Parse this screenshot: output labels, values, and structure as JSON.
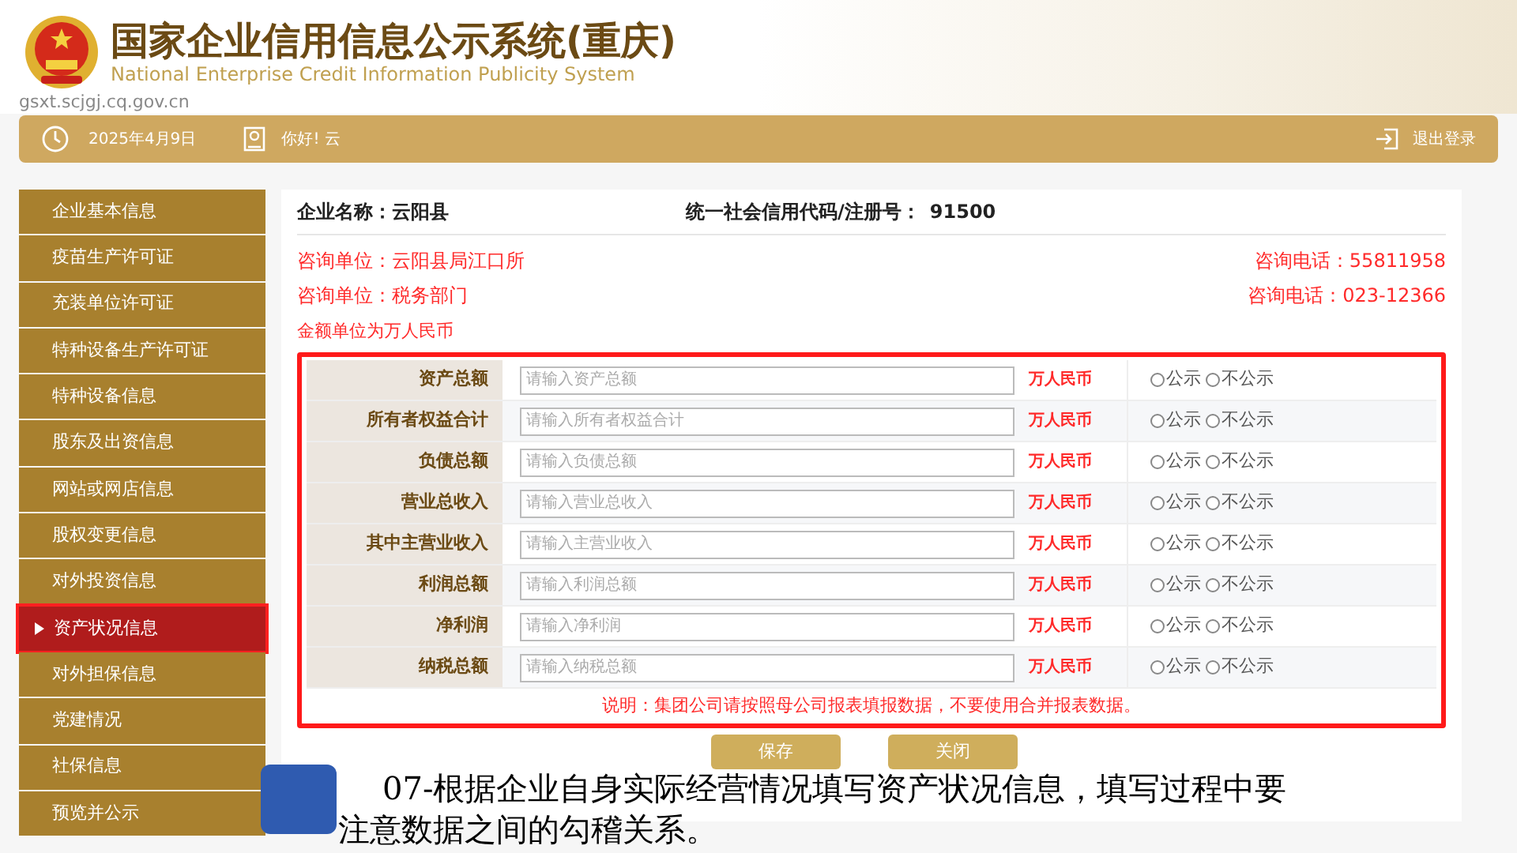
{
  "header": {
    "title": "国家企业信用信息公示系统(重庆)",
    "subtitle": "National Enterprise Credit Information Publicity System",
    "url": "gsxt.scjgj.cq.gov.cn"
  },
  "top_bar": {
    "date": "2025年4月9日",
    "greeting": "你好! 云",
    "logout": "退出登录"
  },
  "sidebar": {
    "items": [
      {
        "label": "企业基本信息",
        "selected": false
      },
      {
        "label": "疫苗生产许可证",
        "selected": false
      },
      {
        "label": "充装单位许可证",
        "selected": false
      },
      {
        "label": "特种设备生产许可证",
        "selected": false
      },
      {
        "label": "特种设备信息",
        "selected": false
      },
      {
        "label": "股东及出资信息",
        "selected": false
      },
      {
        "label": "网站或网店信息",
        "selected": false
      },
      {
        "label": "股权变更信息",
        "selected": false
      },
      {
        "label": "对外投资信息",
        "selected": false
      },
      {
        "label": "资产状况信息",
        "selected": true
      },
      {
        "label": "对外担保信息",
        "selected": false
      },
      {
        "label": "党建情况",
        "selected": false
      },
      {
        "label": "社保信息",
        "selected": false
      },
      {
        "label": "预览并公示",
        "selected": false
      }
    ]
  },
  "company": {
    "name_label": "企业名称：",
    "name": "云阳县",
    "code_label": "统一社会信用代码/注册号：",
    "code": "91500"
  },
  "contacts": [
    {
      "unit": "咨询单位：云阳县局江口所",
      "phone": "咨询电话：55811958"
    },
    {
      "unit": "咨询单位：税务部门",
      "phone": "咨询电话：023-12366"
    }
  ],
  "amount_note": "金额单位为万人民币",
  "form": {
    "rows": [
      {
        "label": "资产总额",
        "placeholder": "请输入资产总额",
        "unit": "万人民币",
        "options": [
          {
            "label": "公示",
            "checked": false
          },
          {
            "label": "不公示",
            "checked": false
          }
        ]
      },
      {
        "label": "所有者权益合计",
        "placeholder": "请输入所有者权益合计",
        "unit": "万人民币",
        "options": [
          {
            "label": "公示",
            "checked": false
          },
          {
            "label": "不公示",
            "checked": false
          }
        ]
      },
      {
        "label": "负债总额",
        "placeholder": "请输入负债总额",
        "unit": "万人民币",
        "options": [
          {
            "label": "公示",
            "checked": false
          },
          {
            "label": "不公示",
            "checked": false
          }
        ]
      },
      {
        "label": "营业总收入",
        "placeholder": "请输入营业总收入",
        "unit": "万人民币",
        "options": [
          {
            "label": "公示",
            "checked": false
          },
          {
            "label": "不公示",
            "checked": false
          }
        ]
      },
      {
        "label": "其中主营业收入",
        "placeholder": "请输入主营业收入",
        "unit": "万人民币",
        "options": [
          {
            "label": "公示",
            "checked": false
          },
          {
            "label": "不公示",
            "checked": false
          }
        ]
      },
      {
        "label": "利润总额",
        "placeholder": "请输入利润总额",
        "unit": "万人民币",
        "options": [
          {
            "label": "公示",
            "checked": false
          },
          {
            "label": "不公示",
            "checked": false
          }
        ]
      },
      {
        "label": "净利润",
        "placeholder": "请输入净利润",
        "unit": "万人民币",
        "options": [
          {
            "label": "公示",
            "checked": false
          },
          {
            "label": "不公示",
            "checked": false
          }
        ]
      },
      {
        "label": "纳税总额",
        "placeholder": "请输入纳税总额",
        "unit": "万人民币",
        "options": [
          {
            "label": "公示",
            "checked": false
          },
          {
            "label": "不公示",
            "checked": false
          }
        ]
      }
    ],
    "note": "说明：集团公司请按照母公司报表填报数据，不要使用合并报表数据。"
  },
  "buttons": [
    "保存",
    "关闭"
  ],
  "caption": [
    "07-根据企业自身实际经营情况填写资产状况信息，填写过程中要",
    "注意数据之间的勾稽关系。"
  ]
}
